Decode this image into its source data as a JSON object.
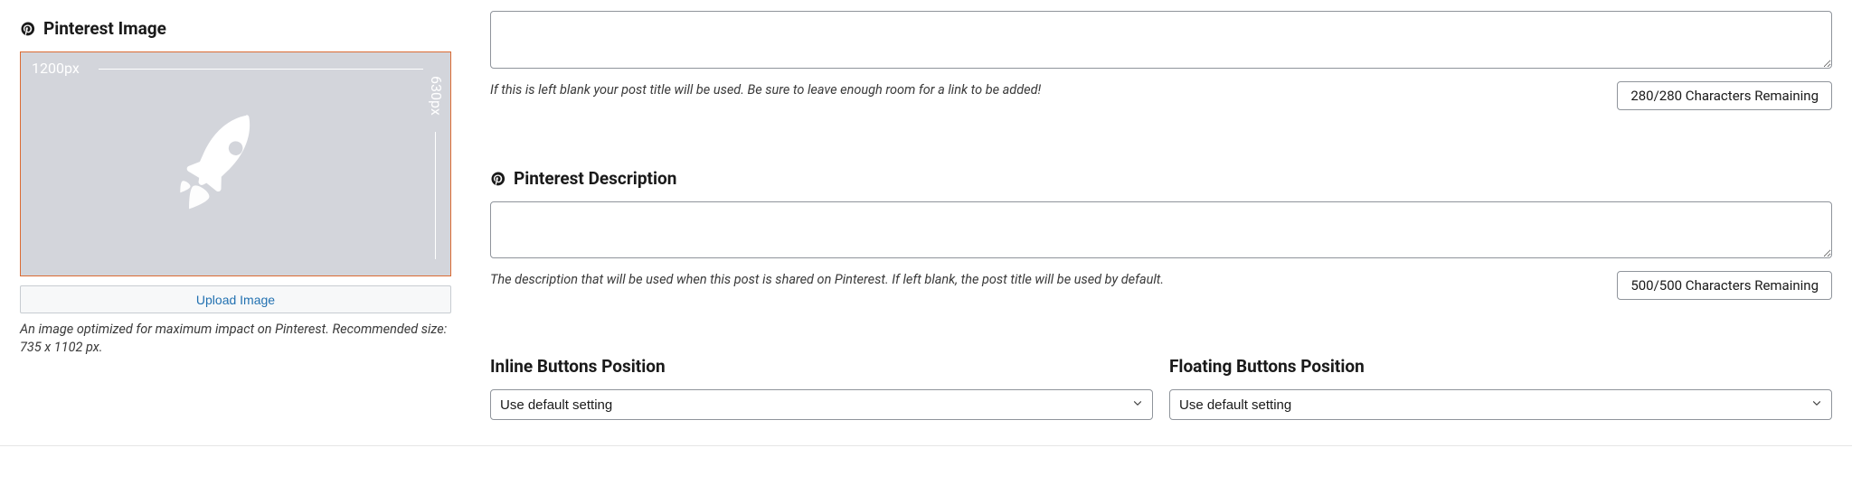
{
  "pinterest_image": {
    "heading": "Pinterest Image",
    "width_label": "1200px",
    "height_label": "630px",
    "upload_label": "Upload Image",
    "help": "An image optimized for maximum impact on Pinterest. Recommended size: 735 x 1102 px."
  },
  "title_field": {
    "value": "",
    "hint": "If this is left blank your post title will be used. Be sure to leave enough room for a link to be added!",
    "counter": "280/280 Characters Remaining"
  },
  "pinterest_description": {
    "heading": "Pinterest Description",
    "value": "",
    "hint": "The description that will be used when this post is shared on Pinterest. If left blank, the post title will be used by default.",
    "counter": "500/500 Characters Remaining"
  },
  "inline_buttons": {
    "heading": "Inline Buttons Position",
    "selected": "Use default setting"
  },
  "floating_buttons": {
    "heading": "Floating Buttons Position",
    "selected": "Use default setting"
  }
}
